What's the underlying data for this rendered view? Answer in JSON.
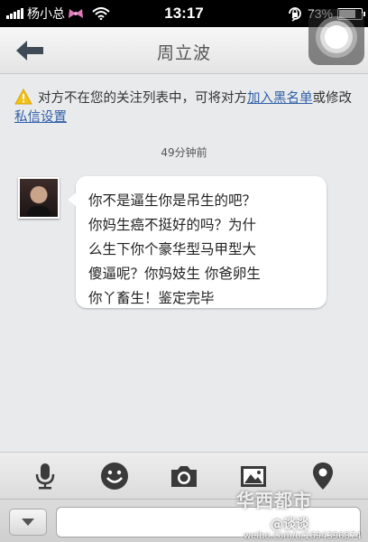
{
  "status_bar": {
    "carrier": "杨小总",
    "time": "13:17",
    "battery": "73%",
    "battery_level": 0.73,
    "icons": [
      "signal-bars-icon",
      "bow-icon",
      "wifi-icon",
      "rotation-lock-icon",
      "battery-icon"
    ]
  },
  "nav": {
    "title": "周立波",
    "back_icon": "back-arrow-icon",
    "overlay_icon": "assistive-touch-icon"
  },
  "notice": {
    "icon": "warning-icon",
    "text_before": "对方不在您的关注列表中，可将对方",
    "link_blacklist": "加入黑名单",
    "text_middle": "或修改",
    "link_privacy": "私信设置"
  },
  "timestamp": "49分钟前",
  "message": {
    "avatar": "avatar",
    "lines": [
      "你不是逼生你是吊生的吧？",
      "你妈生癌不挺好的吗？为什",
      "么生下你个豪华型马甲型大",
      "傻逼呢？你妈妓生 你爸卵生",
      "你丫畜生！鉴定完毕"
    ]
  },
  "toolbar": {
    "icons": [
      "microphone-icon",
      "emoji-icon",
      "camera-icon",
      "image-icon",
      "location-icon"
    ]
  },
  "input": {
    "expand_icon": "chevron-down-icon",
    "value": ""
  },
  "watermark": {
    "logo": "华西都市",
    "handle": "@谈谈",
    "url": "weibo.com/u/1694396874"
  },
  "colors": {
    "link": "#2f5fa8",
    "warning": "#f2c21a",
    "icon_dark": "#3a3a3a"
  }
}
